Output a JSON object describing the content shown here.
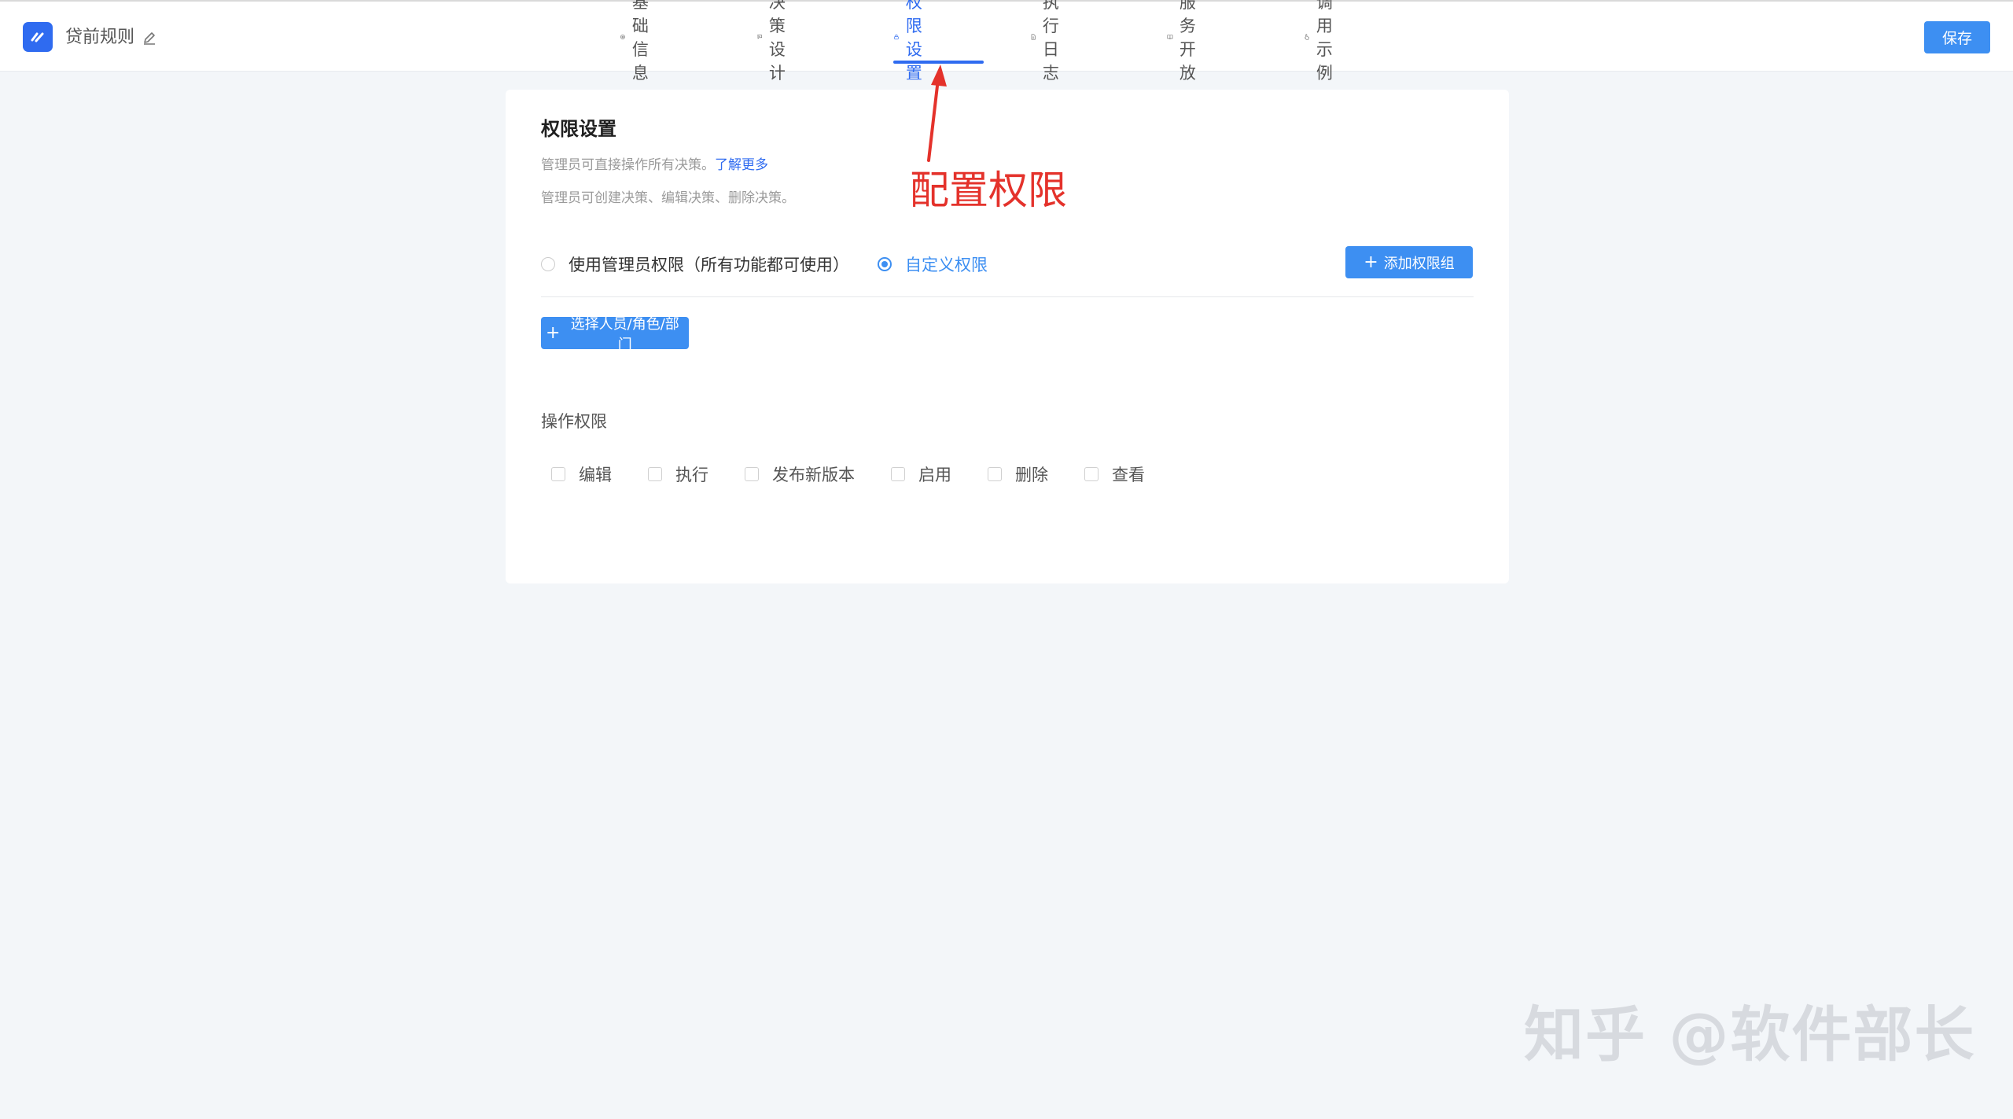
{
  "header": {
    "app_name": "贷前规则",
    "save_label": "保存"
  },
  "nav": {
    "tabs": [
      {
        "label": "基础信息",
        "icon": "gear-icon"
      },
      {
        "label": "决策设计",
        "icon": "flag-icon"
      },
      {
        "label": "权限设置",
        "icon": "lock-icon",
        "active": true
      },
      {
        "label": "执行日志",
        "icon": "document-icon"
      },
      {
        "label": "服务开放",
        "icon": "book-icon"
      },
      {
        "label": "调用示例",
        "icon": "pointer-hand-icon"
      }
    ]
  },
  "card": {
    "title": "权限设置",
    "desc_line1": "管理员可直接操作所有决策。",
    "learn_more": "了解更多",
    "desc_line2": "管理员可创建决策、编辑决策、删除决策。",
    "radio_admin": "使用管理员权限（所有功能都可使用）",
    "radio_custom": "自定义权限",
    "add_group_label": "添加权限组",
    "select_label": "选择人员/角色/部门",
    "operations_label": "操作权限",
    "permissions": [
      "编辑",
      "执行",
      "发布新版本",
      "启用",
      "删除",
      "查看"
    ]
  },
  "annotation": {
    "text": "配置权限",
    "color": "#e4322b"
  },
  "watermark": "知乎 @软件部长",
  "colors": {
    "accent": "#2f6bf0",
    "button": "#3d8ff2",
    "background": "#f3f6f9"
  }
}
